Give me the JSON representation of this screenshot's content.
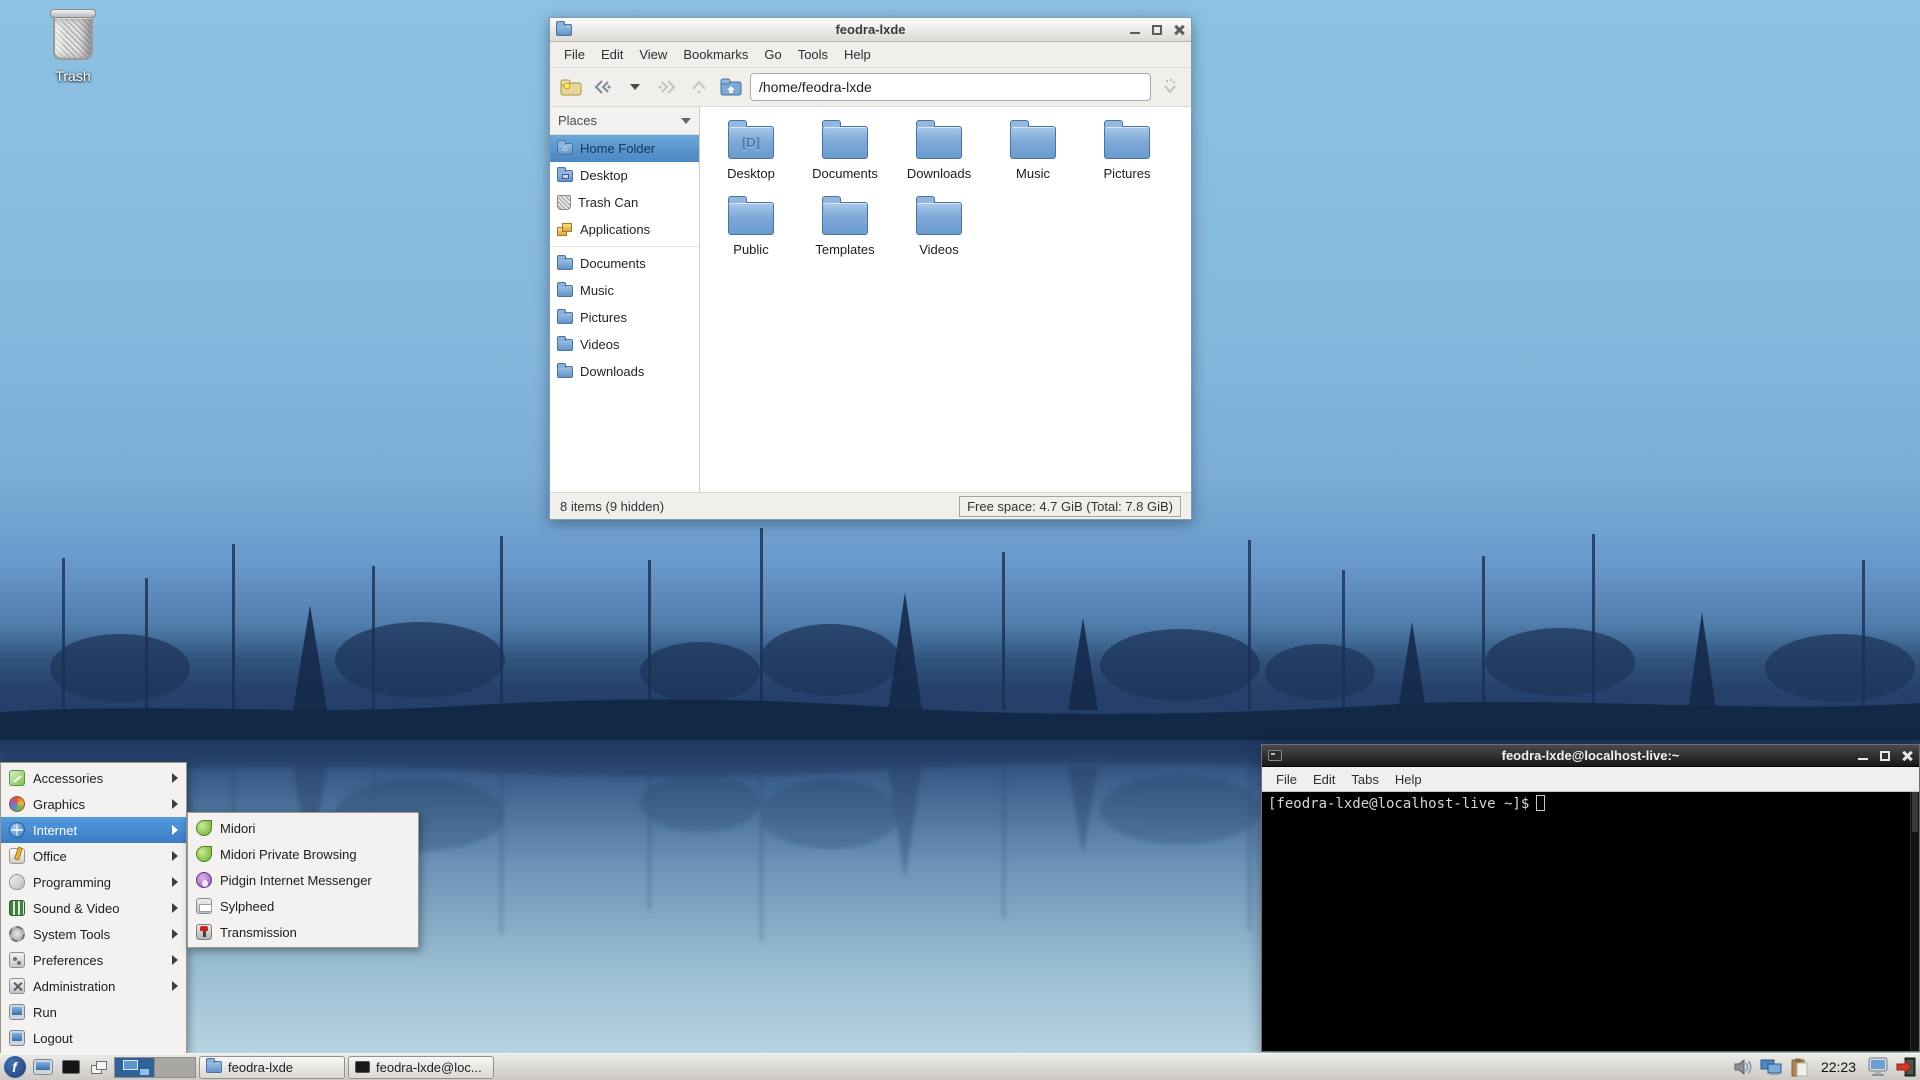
{
  "desktop": {
    "trash_label": "Trash"
  },
  "colors": {
    "selection_blue": "#4a88c4",
    "menu_highlight": "#3b7cc4",
    "terminal_background": "#000000",
    "terminal_text": "#d3d7cf",
    "sky_blue": "#8ec2e4",
    "taskbar_gray": "#cdcac5",
    "folder_blue": "#7fa9d8"
  },
  "file_manager": {
    "title": "feodra-lxde",
    "menu": [
      "File",
      "Edit",
      "View",
      "Bookmarks",
      "Go",
      "Tools",
      "Help"
    ],
    "path": "/home/feodra-lxde",
    "places_header": "Places",
    "places": [
      {
        "label": "Home Folder",
        "icon": "home-folder-icon",
        "selected": true
      },
      {
        "label": "Desktop",
        "icon": "desktop-folder-icon",
        "selected": false
      },
      {
        "label": "Trash Can",
        "icon": "trash-can-icon",
        "selected": false
      },
      {
        "label": "Applications",
        "icon": "applications-icon",
        "selected": false
      },
      {
        "label": "Documents",
        "icon": "folder-icon",
        "selected": false
      },
      {
        "label": "Music",
        "icon": "folder-icon",
        "selected": false
      },
      {
        "label": "Pictures",
        "icon": "folder-icon",
        "selected": false
      },
      {
        "label": "Videos",
        "icon": "folder-icon",
        "selected": false
      },
      {
        "label": "Downloads",
        "icon": "folder-icon",
        "selected": false
      }
    ],
    "folders": [
      "Desktop",
      "Documents",
      "Downloads",
      "Music",
      "Pictures",
      "Public",
      "Templates",
      "Videos"
    ],
    "status_left": "8 items (9 hidden)",
    "status_right": "Free space: 4.7 GiB (Total: 7.8 GiB)"
  },
  "terminal": {
    "title": "feodra-lxde@localhost-live:~",
    "menu": [
      "File",
      "Edit",
      "Tabs",
      "Help"
    ],
    "prompt": "[feodra-lxde@localhost-live ~]$"
  },
  "start_menu": {
    "items": [
      {
        "label": "Accessories",
        "icon": "accessories-icon",
        "has_submenu": true
      },
      {
        "label": "Graphics",
        "icon": "graphics-icon",
        "has_submenu": true
      },
      {
        "label": "Internet",
        "icon": "internet-icon",
        "has_submenu": true,
        "selected": true
      },
      {
        "label": "Office",
        "icon": "office-icon",
        "has_submenu": true
      },
      {
        "label": "Programming",
        "icon": "programming-icon",
        "has_submenu": true
      },
      {
        "label": "Sound & Video",
        "icon": "sound-video-icon",
        "has_submenu": true
      },
      {
        "label": "System Tools",
        "icon": "system-tools-icon",
        "has_submenu": true
      },
      {
        "label": "Preferences",
        "icon": "preferences-icon",
        "has_submenu": true
      },
      {
        "label": "Administration",
        "icon": "administration-icon",
        "has_submenu": true
      },
      {
        "label": "Run",
        "icon": "run-icon",
        "has_submenu": false
      },
      {
        "label": "Logout",
        "icon": "logout-icon",
        "has_submenu": false
      }
    ],
    "internet_submenu": [
      {
        "label": "Midori",
        "icon": "midori-icon"
      },
      {
        "label": "Midori Private Browsing",
        "icon": "midori-icon"
      },
      {
        "label": "Pidgin Internet Messenger",
        "icon": "pidgin-icon"
      },
      {
        "label": "Sylpheed",
        "icon": "sylpheed-icon"
      },
      {
        "label": "Transmission",
        "icon": "transmission-icon"
      }
    ]
  },
  "taskbar": {
    "tasks": [
      {
        "label": "feodra-lxde",
        "icon": "folder-icon"
      },
      {
        "label": "feodra-lxde@loc...",
        "icon": "terminal-icon"
      }
    ],
    "clock": "22:23"
  }
}
